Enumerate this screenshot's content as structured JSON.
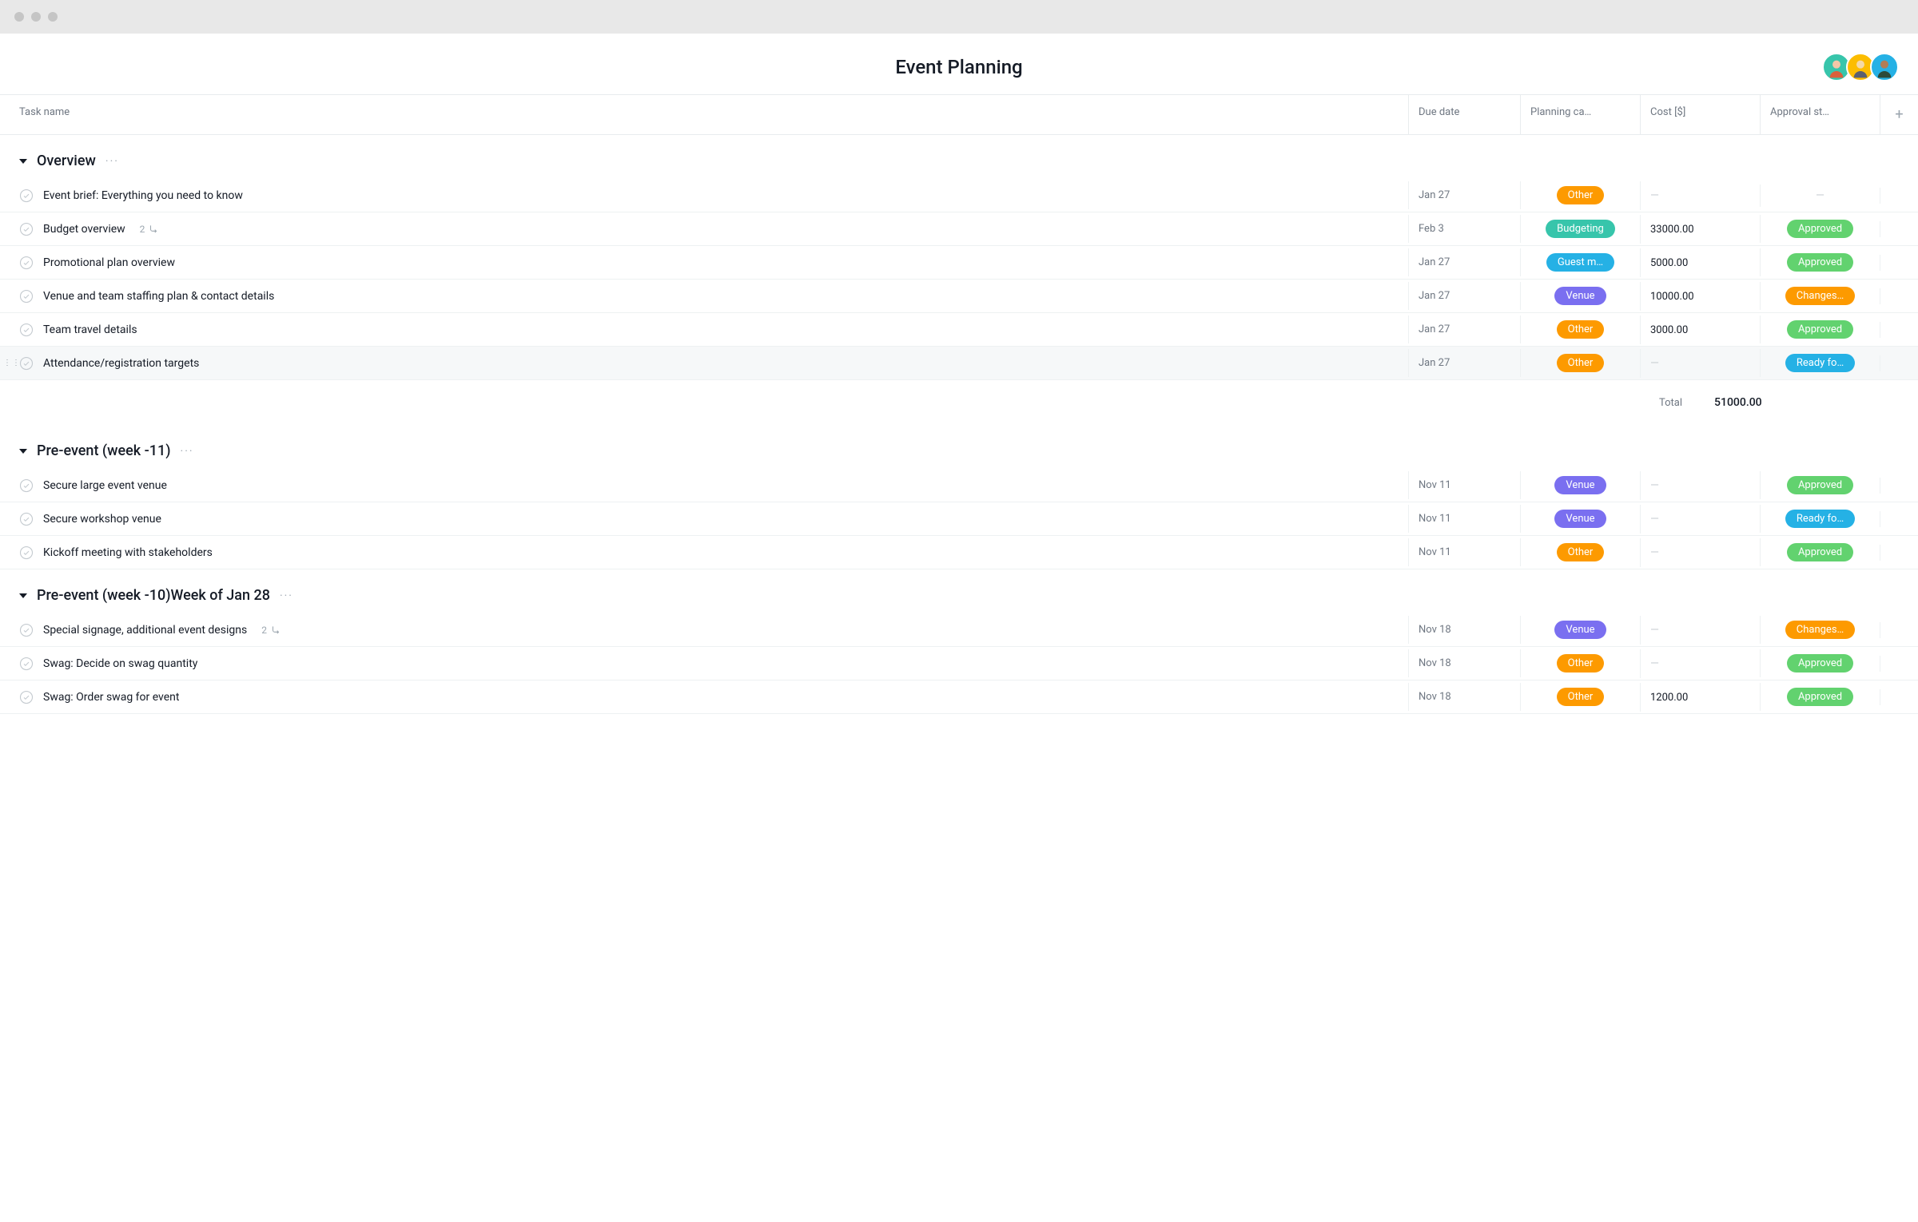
{
  "header": {
    "title": "Event Planning"
  },
  "columns": {
    "task_name": "Task name",
    "due_date": "Due date",
    "planning_category": "Planning ca…",
    "cost": "Cost [$]",
    "approval_status": "Approval st…",
    "add": "+"
  },
  "category_colors": {
    "Other": "pill-orange",
    "Budgeting": "pill-teal",
    "Guest m…": "pill-blue",
    "Venue": "pill-purple"
  },
  "approval_colors": {
    "Approved": "pill-green",
    "Changes…": "pill-orange",
    "Ready fo…": "pill-blue"
  },
  "totals_label": "Total",
  "sections": [
    {
      "title": "Overview",
      "total": "51000.00",
      "tasks": [
        {
          "name": "Event brief: Everything you need to know",
          "due": "Jan 27",
          "category": "Other",
          "cost": "",
          "approval": ""
        },
        {
          "name": "Budget overview",
          "subtasks": "2",
          "due": "Feb 3",
          "category": "Budgeting",
          "cost": "33000.00",
          "approval": "Approved"
        },
        {
          "name": "Promotional plan overview",
          "due": "Jan 27",
          "category": "Guest m…",
          "cost": "5000.00",
          "approval": "Approved"
        },
        {
          "name": "Venue and team staffing plan & contact details",
          "due": "Jan 27",
          "category": "Venue",
          "cost": "10000.00",
          "approval": "Changes…"
        },
        {
          "name": "Team travel details",
          "due": "Jan 27",
          "category": "Other",
          "cost": "3000.00",
          "approval": "Approved"
        },
        {
          "name": "Attendance/registration targets",
          "due": "Jan 27",
          "category": "Other",
          "cost": "",
          "approval": "Ready fo…",
          "hovered": true
        }
      ]
    },
    {
      "title": "Pre-event (week -11)",
      "tasks": [
        {
          "name": "Secure large event venue",
          "due": "Nov 11",
          "category": "Venue",
          "cost": "",
          "approval": "Approved"
        },
        {
          "name": "Secure workshop venue",
          "due": "Nov 11",
          "category": "Venue",
          "cost": "",
          "approval": "Ready fo…"
        },
        {
          "name": "Kickoff meeting with stakeholders",
          "due": "Nov 11",
          "category": "Other",
          "cost": "",
          "approval": "Approved"
        }
      ]
    },
    {
      "title": "Pre-event (week -10)Week of Jan 28",
      "tasks": [
        {
          "name": "Special signage, additional event designs",
          "subtasks": "2",
          "due": "Nov 18",
          "category": "Venue",
          "cost": "",
          "approval": "Changes…"
        },
        {
          "name": "Swag: Decide on swag quantity",
          "due": "Nov 18",
          "category": "Other",
          "cost": "",
          "approval": "Approved"
        },
        {
          "name": "Swag: Order swag for event",
          "due": "Nov 18",
          "category": "Other",
          "cost": "1200.00",
          "approval": "Approved"
        }
      ]
    }
  ]
}
